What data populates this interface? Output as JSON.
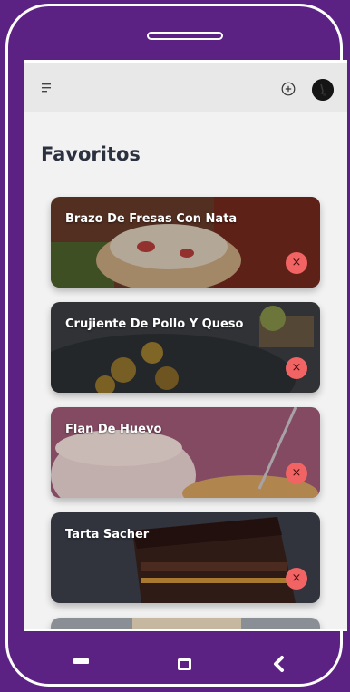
{
  "page": {
    "title": "Favoritos"
  },
  "appbar": {
    "menu_icon": "menu-icon",
    "add_icon": "add-circle-icon",
    "avatar_icon": "avatar"
  },
  "favorites": [
    {
      "title": "Brazo De Fresas Con Nata",
      "remove_label": "×"
    },
    {
      "title": "Crujiente De Pollo Y Queso",
      "remove_label": "×"
    },
    {
      "title": "Flan De Huevo",
      "remove_label": "×"
    },
    {
      "title": "Tarta Sacher",
      "remove_label": "×"
    }
  ],
  "nav": {
    "recent_icon": "recent-apps-icon",
    "home_icon": "home-icon",
    "back_icon": "back-icon"
  },
  "colors": {
    "frame": "#5b2283",
    "screen_bg": "#f2f2f2",
    "appbar_bg": "#e8e8e8",
    "title": "#2c3140",
    "remove_button": "#f26464"
  }
}
